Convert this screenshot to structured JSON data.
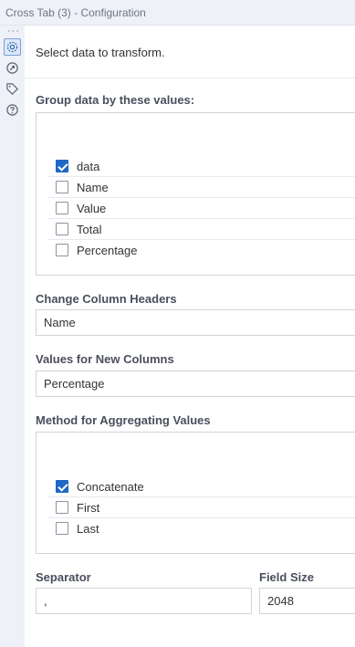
{
  "window": {
    "title": "Cross Tab (3) - Configuration"
  },
  "rail": {
    "more": "···",
    "icons": [
      "gear-icon",
      "connection-icon",
      "tag-icon",
      "help-icon"
    ]
  },
  "prompt": "Select data to transform.",
  "group_by": {
    "label": "Group data by these values:",
    "fields": [
      {
        "label": "data",
        "checked": true
      },
      {
        "label": "Name",
        "checked": false
      },
      {
        "label": "Value",
        "checked": false
      },
      {
        "label": "Total",
        "checked": false
      },
      {
        "label": "Percentage",
        "checked": false
      }
    ]
  },
  "headers": {
    "label": "Change Column Headers",
    "value": "Name"
  },
  "values_new": {
    "label": "Values for New Columns",
    "value": "Percentage"
  },
  "method": {
    "label": "Method for Aggregating Values",
    "options": [
      {
        "label": "Concatenate",
        "checked": true
      },
      {
        "label": "First",
        "checked": false
      },
      {
        "label": "Last",
        "checked": false
      }
    ]
  },
  "separator": {
    "label": "Separator",
    "value": ","
  },
  "field_size": {
    "label": "Field Size",
    "value": "2048"
  },
  "colors": {
    "accent": "#1f67c5",
    "border": "#cfd4dc"
  }
}
